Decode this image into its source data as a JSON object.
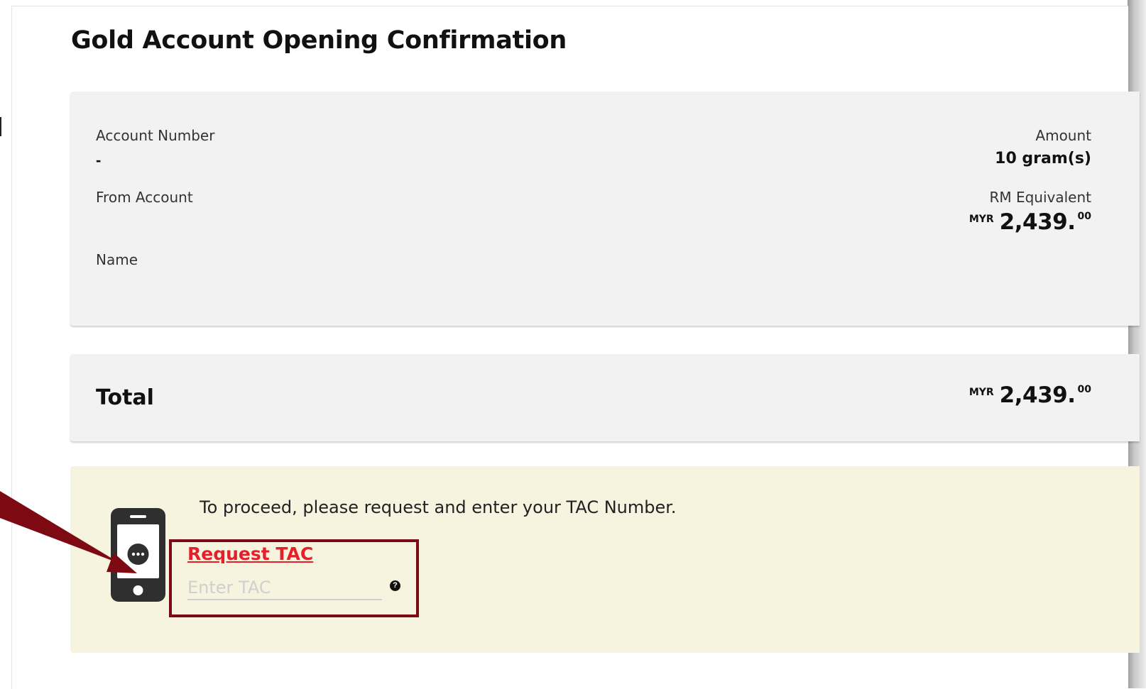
{
  "page_title": "Gold Account Opening Confirmation",
  "details": {
    "account_number_label": "Account Number",
    "account_number_value": "-",
    "from_account_label": "From Account",
    "name_label": "Name",
    "amount_label": "Amount",
    "amount_value": "10 gram(s)",
    "rm_equivalent_label": "RM Equivalent",
    "rm_equivalent": {
      "currency": "MYR",
      "main": "2,439.",
      "cents": "00"
    }
  },
  "total": {
    "label": "Total",
    "currency": "MYR",
    "main": "2,439.",
    "cents": "00"
  },
  "tac": {
    "message": "To proceed, please request and enter your TAC Number.",
    "request_label": "Request TAC",
    "input_placeholder": "Enter TAC",
    "help_icon": "question-icon",
    "phone_icon": "mobile-phone-chat-icon"
  },
  "colors": {
    "request_tac": "#e4202b",
    "highlight_box": "#7d0a12",
    "arrow": "#7d0a12",
    "panel": "#f2f2f2",
    "tac_panel": "#f6f4df"
  }
}
